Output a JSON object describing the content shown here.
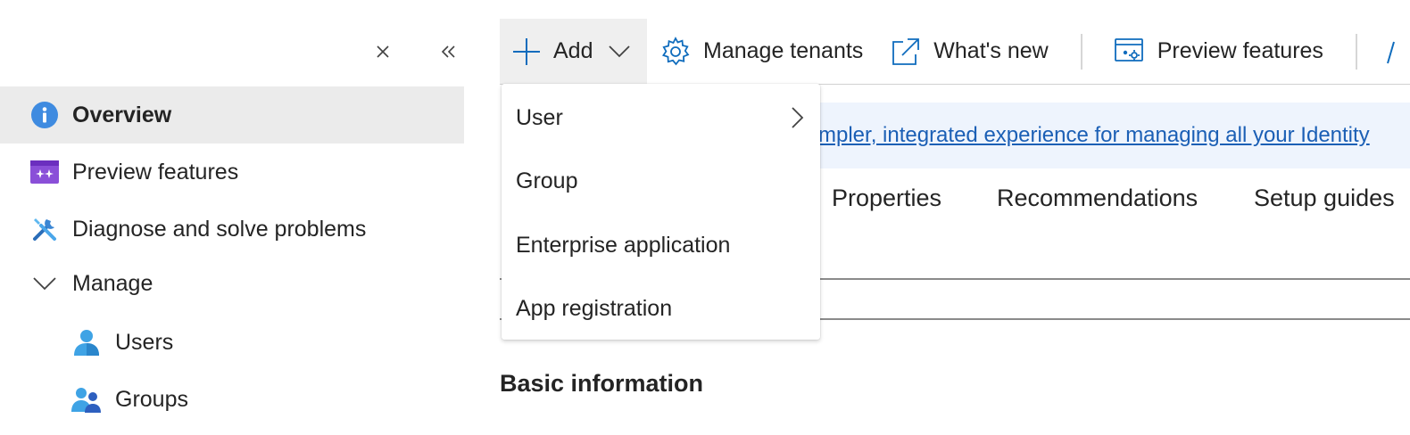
{
  "nav": {
    "close_icon": "close-icon",
    "collapse_icon": "double-chevron-left-icon",
    "items": [
      {
        "label": "Overview",
        "icon": "info-icon",
        "selected": true
      },
      {
        "label": "Preview features",
        "icon": "preview-features-icon"
      },
      {
        "label": "Diagnose and solve problems",
        "icon": "wrench-screwdriver-icon"
      },
      {
        "label": "Manage",
        "icon": "chevron-down-icon",
        "expanded": true
      },
      {
        "label": "Users",
        "icon": "user-icon",
        "indent": 1
      },
      {
        "label": "Groups",
        "icon": "group-icon",
        "indent": 1
      }
    ]
  },
  "toolbar": {
    "add_label": "Add",
    "manage_tenants_label": "Manage tenants",
    "whats_new_label": "What's new",
    "preview_features_label": "Preview features"
  },
  "add_menu": {
    "items": [
      {
        "label": "User",
        "has_submenu": true
      },
      {
        "label": "Group"
      },
      {
        "label": "Enterprise application"
      },
      {
        "label": "App registration"
      }
    ]
  },
  "banner": {
    "link_text": "mpler, integrated experience for managing all your Identity"
  },
  "tabs": [
    {
      "label": "Properties"
    },
    {
      "label": "Recommendations"
    },
    {
      "label": "Setup guides"
    }
  ],
  "section": {
    "title": "Basic information"
  },
  "colors": {
    "accent": "#0f6cbd",
    "link": "#1b5fb5",
    "selected_bg": "#ebebeb",
    "banner_bg": "#eef4fd",
    "preview_purple": "#8a4fd8"
  }
}
